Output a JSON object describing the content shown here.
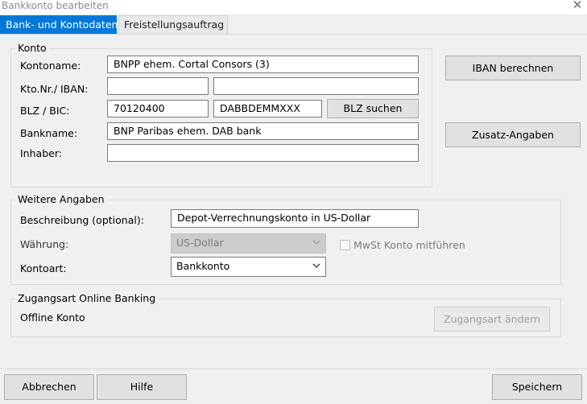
{
  "window": {
    "title": "Bankkonto bearbeiten",
    "close_glyph": "✕"
  },
  "tabs": [
    {
      "label": "Bank- und Kontodaten",
      "active": true
    },
    {
      "label": "Freistellungsauftrag",
      "active": false
    }
  ],
  "konto": {
    "legend": "Konto",
    "kontoname_label": "Kontoname:",
    "kontoname_value": "BNPP ehem. Cortal Consors (3)",
    "ktonr_label": "Kto.Nr./ IBAN:",
    "ktonr_value": "",
    "iban_value": "",
    "blz_label": "BLZ / BIC:",
    "blz_value": "70120400",
    "bic_value": "DABBDEMMXXX",
    "blz_suchen": "BLZ suchen",
    "bankname_label": "Bankname:",
    "bankname_value": "BNP Paribas ehem. DAB bank",
    "inhaber_label": "Inhaber:",
    "inhaber_value": ""
  },
  "side_buttons": {
    "iban_berechnen": "IBAN berechnen",
    "zusatz_angaben": "Zusatz-Angaben"
  },
  "weitere": {
    "legend": "Weitere Angaben",
    "beschreibung_label": "Beschreibung (optional):",
    "beschreibung_value": "Depot-Verrechnungskonto in US-Dollar",
    "waehrung_label": "Währung:",
    "waehrung_value": "US-Dollar",
    "mwst_label": "MwSt Konto mitführen",
    "mwst_checked": false,
    "kontoart_label": "Kontoart:",
    "kontoart_value": "Bankkonto"
  },
  "zugang": {
    "legend": "Zugangsart Online Banking",
    "status": "Offline Konto",
    "aendern_button": "Zugangsart ändern"
  },
  "footer": {
    "abbrechen": "Abbrechen",
    "hilfe": "Hilfe",
    "speichern": "Speichern"
  },
  "colors": {
    "accent": "#0078d7",
    "dialog_bg": "#f0f0f0"
  }
}
